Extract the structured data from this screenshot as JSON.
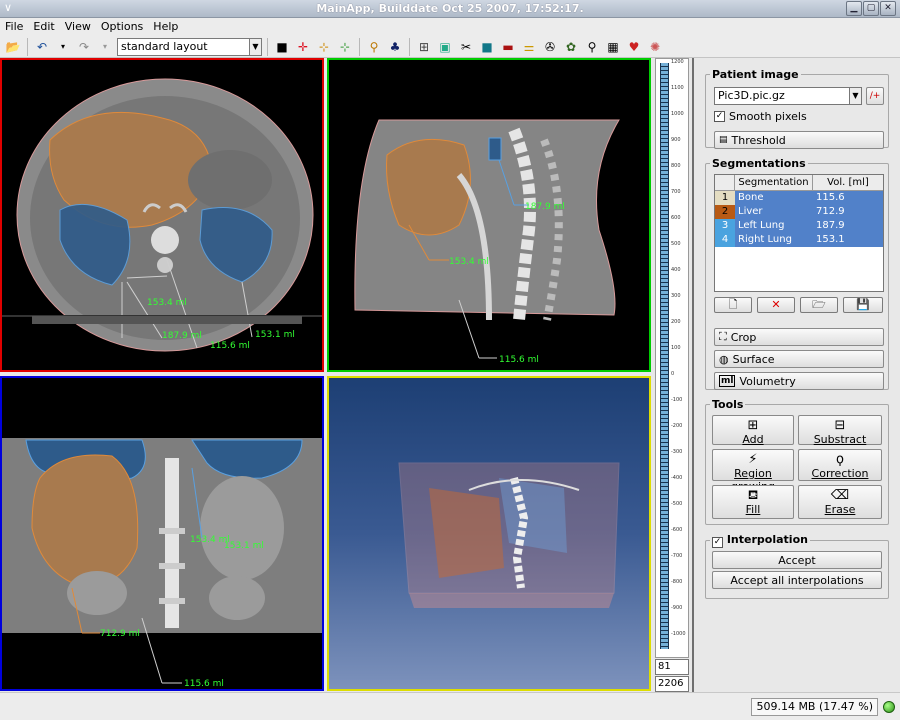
{
  "window": {
    "title": "MainApp, Builddate Oct 25 2007, 17:52:17.",
    "system_menu": "∨",
    "controls": [
      "▁",
      "▢",
      "✕"
    ]
  },
  "menu": [
    "File",
    "Edit",
    "View",
    "Options",
    "Help"
  ],
  "toolbar": {
    "layout_value": "standard layout",
    "icons": [
      "open-icon",
      "undo-icon",
      "undo-dropdown-icon",
      "redo-icon",
      "redo-dropdown-icon",
      "single-view-icon",
      "crosshair-icon",
      "measure-icon",
      "annotate-icon",
      "pointset-icon",
      "volume-icon",
      "grid-icon",
      "mpr-icon",
      "cut-icon",
      "cube-icon",
      "slice-icon",
      "ruler-icon",
      "camera-icon",
      "segmentation-icon",
      "lasso-icon",
      "table-icon",
      "heart-icon",
      "brain-icon"
    ]
  },
  "views": {
    "top_left": {
      "border": "#e00000",
      "measurements": [
        "153.4 ml",
        "187.9 ml",
        "115.6 ml",
        "153.1 ml"
      ]
    },
    "top_right": {
      "border": "#00cc00",
      "measurements": [
        "187.9 ml",
        "153.4 ml",
        "115.6 ml"
      ]
    },
    "bottom_left": {
      "border": "#0000dd",
      "measurements": [
        "153.4 ml",
        "153.1 ml",
        "712.9 ml",
        "115.6 ml"
      ]
    },
    "bottom_right": {
      "border": "#dddd00"
    }
  },
  "levelwindow": {
    "ticks": [
      "1200",
      "1100",
      "1000",
      "900",
      "800",
      "700",
      "600",
      "500",
      "400",
      "300",
      "200",
      "100",
      "0",
      "-100",
      "-200",
      "-300",
      "-400",
      "-500",
      "-600",
      "-700",
      "-800",
      "-900",
      "-1000"
    ],
    "level": "81",
    "window": "2206"
  },
  "panel": {
    "patient_image": {
      "title": "Patient image",
      "file": "Pic3D.pic.gz",
      "smooth_pixels": "Smooth pixels",
      "smooth_checked": true,
      "threshold": "Threshold"
    },
    "segmentations": {
      "title": "Segmentations",
      "col_segmentation": "Segmentation",
      "col_volume": "Vol. [ml]",
      "rows": [
        {
          "num": "1",
          "name": "Bone",
          "vol": "115.6",
          "color": "#e4ddc2"
        },
        {
          "num": "2",
          "name": "Liver",
          "vol": "712.9",
          "color": "#b85a14"
        },
        {
          "num": "3",
          "name": "Left Lung",
          "vol": "187.9",
          "color": "#4aa3df"
        },
        {
          "num": "4",
          "name": "Right Lung",
          "vol": "153.1",
          "color": "#4aa3df"
        }
      ],
      "crop": "Crop",
      "surface": "Surface",
      "volumetry": "Volumetry",
      "volumetry_icon_text": "ml"
    },
    "tools": {
      "title": "Tools",
      "add": "Add",
      "subtract": "Substract",
      "region_growing": "Region growing",
      "correction": "Correction",
      "fill": "Fill",
      "erase": "Erase"
    },
    "interpolation": {
      "title": "Interpolation",
      "checked": true,
      "accept": "Accept",
      "accept_all": "Accept all interpolations"
    }
  },
  "status": {
    "memory": "509.14 MB (17.47 %)"
  }
}
